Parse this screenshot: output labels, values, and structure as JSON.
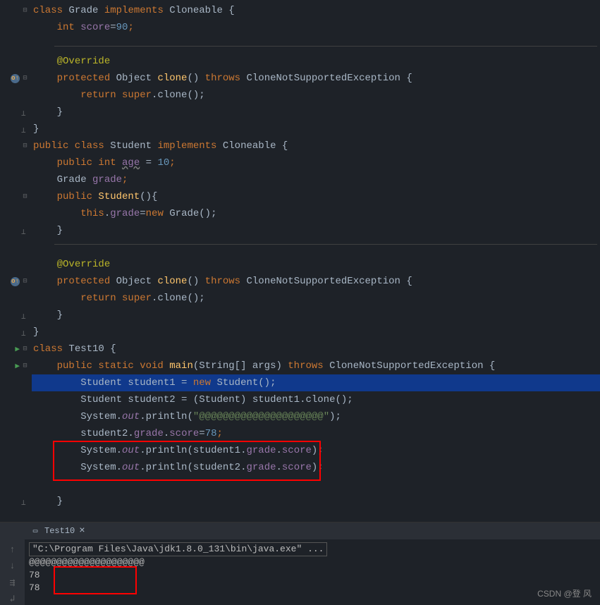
{
  "code": {
    "l1_kw1": "class ",
    "l1_cls": "Grade ",
    "l1_kw2": "implements ",
    "l1_cls2": "Cloneable {",
    "l2_kw": "int ",
    "l2_field": "score",
    "l2_eq": "=",
    "l2_num": "90",
    "l2_semi": ";",
    "l3_ann": "@Override",
    "l4_kw1": "protected ",
    "l4_ret": "Object ",
    "l4_method": "clone",
    "l4_paren": "() ",
    "l4_kw2": "throws ",
    "l4_exc": "CloneNotSupportedException {",
    "l5_kw": "return super",
    "l5_rest": ".clone();",
    "l6": "}",
    "l7": "}",
    "l8_kw1": "public class ",
    "l8_cls": "Student ",
    "l8_kw2": "implements ",
    "l8_cls2": "Cloneable {",
    "l9_kw": "public int ",
    "l9_field": "age",
    "l9_eq": " = ",
    "l9_num": "10",
    "l9_semi": ";",
    "l10_cls": "Grade ",
    "l10_field": "grade",
    "l10_semi": ";",
    "l11_kw": "public ",
    "l11_method": "Student",
    "l11_rest": "(){",
    "l12_kw": "this",
    "l12_dot": ".",
    "l12_field": "grade",
    "l12_eq": "=",
    "l12_kw2": "new ",
    "l12_rest": "Grade();",
    "l13": "}",
    "l14_ann": "@Override",
    "l15_kw1": "protected ",
    "l15_ret": "Object ",
    "l15_method": "clone",
    "l15_paren": "() ",
    "l15_kw2": "throws ",
    "l15_exc": "CloneNotSupportedException {",
    "l16_kw": "return super",
    "l16_rest": ".clone();",
    "l17": "}",
    "l18": "}",
    "l19_kw": "class ",
    "l19_cls": "Test10 {",
    "l20_kw1": "public static void ",
    "l20_method": "main",
    "l20_p1": "(String[] args) ",
    "l20_kw2": "throws ",
    "l20_exc": "CloneNotSupportedException {",
    "l21_cls": "Student student1 = ",
    "l21_kw": "new ",
    "l21_rest": "Student();",
    "l22": "Student student2 = (Student) student1.clone();",
    "l23_a": "System.",
    "l23_out": "out",
    "l23_b": ".println(",
    "l23_str": "\"@@@@@@@@@@@@@@@@@@@@@\"",
    "l23_c": ");",
    "l24_a": "student2.",
    "l24_f1": "grade",
    "l24_b": ".",
    "l24_f2": "score",
    "l24_c": "=",
    "l24_num": "78",
    "l24_semi": ";",
    "l25_a": "System.",
    "l25_out": "out",
    "l25_b": ".println(student1.",
    "l25_f1": "grade",
    "l25_c": ".",
    "l25_f2": "score",
    "l25_d": ");",
    "l26_a": "System.",
    "l26_out": "out",
    "l26_b": ".println(student2.",
    "l26_f1": "grade",
    "l26_c": ".",
    "l26_f2": "score",
    "l26_d": ");",
    "l27": "}"
  },
  "terminal": {
    "tab": "Test10",
    "cmd": "\"C:\\Program Files\\Java\\jdk1.8.0_131\\bin\\java.exe\" ...",
    "out1": "@@@@@@@@@@@@@@@@@@@@@",
    "out2": "78",
    "out3": "78"
  },
  "watermark": "CSDN @登 风"
}
